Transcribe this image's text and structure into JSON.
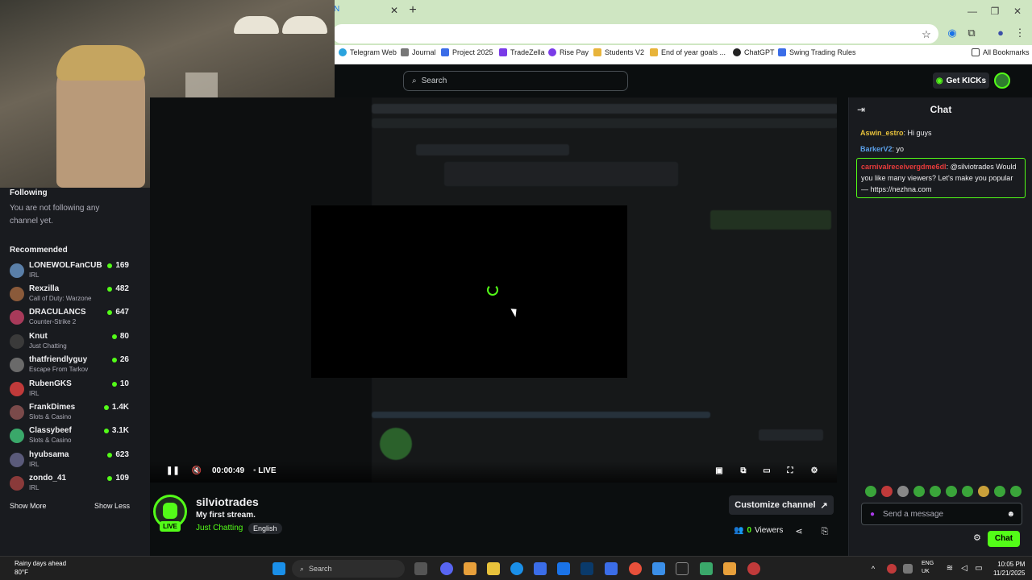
{
  "browser": {
    "close_glyph": "✕",
    "new_tab_glyph": "+",
    "bookmarks": [
      {
        "label": "Telegram Web",
        "color": "#2aa3de"
      },
      {
        "label": "Journal",
        "color": "#777777"
      },
      {
        "label": "Project 2025",
        "color": "#3b6de8"
      },
      {
        "label": "TradeZella",
        "color": "#7a3be8"
      },
      {
        "label": "Rise Pay",
        "color": "#7a3be8"
      },
      {
        "label": "Students V2",
        "color": "#e8b43b"
      },
      {
        "label": "End of year goals ...",
        "color": "#e8b43b"
      },
      {
        "label": "ChatGPT",
        "color": "#222222"
      },
      {
        "label": "Swing Trading Rules",
        "color": "#3b6de8"
      }
    ],
    "all_bookmarks": "All Bookmarks"
  },
  "header": {
    "search_placeholder": "Search",
    "get_kicks": "Get KICKs"
  },
  "sidebar": {
    "following_heading": "Following",
    "not_following_text": "You are not following any channel yet.",
    "recommended_heading": "Recommended",
    "channels": [
      {
        "name": "LONEWOLFanCUB",
        "category": "IRL",
        "viewers": "169",
        "color": "#5a7fa8"
      },
      {
        "name": "Rexzilla",
        "category": "Call of Duty: Warzone",
        "viewers": "482",
        "color": "#8a5a3a"
      },
      {
        "name": "DRACULANCS",
        "category": "Counter-Strike 2",
        "viewers": "647",
        "color": "#a83a5a"
      },
      {
        "name": "Knut",
        "category": "Just Chatting",
        "viewers": "80",
        "color": "#3a3a3a"
      },
      {
        "name": "thatfriendlyguy",
        "category": "Escape From Tarkov",
        "viewers": "26",
        "color": "#6a6a6a"
      },
      {
        "name": "RubenGKS",
        "category": "IRL",
        "viewers": "10",
        "color": "#c03a3a"
      },
      {
        "name": "FrankDimes",
        "category": "Slots & Casino",
        "viewers": "1.4K",
        "color": "#7a4a4a"
      },
      {
        "name": "Classybeef",
        "category": "Slots & Casino",
        "viewers": "3.1K",
        "color": "#3aa86a"
      },
      {
        "name": "hyubsama",
        "category": "IRL",
        "viewers": "623",
        "color": "#5a5a7a"
      },
      {
        "name": "zondo_41",
        "category": "IRL",
        "viewers": "109",
        "color": "#8a3a3a"
      }
    ],
    "show_more": "Show More",
    "show_less": "Show Less"
  },
  "player": {
    "elapsed": "00:00:49",
    "live_label": "LIVE"
  },
  "stream": {
    "streamer": "silviotrades",
    "title": "My first stream.",
    "category": "Just Chatting",
    "language": "English",
    "live_badge": "LIVE",
    "customize_label": "Customize channel",
    "viewer_count": "0",
    "viewers_label": "Viewers"
  },
  "chat": {
    "title": "Chat",
    "messages": [
      {
        "user": "Aswin_estro",
        "user_color": "#e8c23b",
        "text": ": Hi guys"
      },
      {
        "user": "BarkerV2",
        "user_color": "#5a9fe8",
        "text": ": yo"
      },
      {
        "user": "carnivalreceivergdme6dl",
        "user_color": "#e83b3b",
        "text": ": @silviotrades Would you like many viewers? Let's make you popular — https://nezhna.com"
      }
    ],
    "input_placeholder": "Send a message",
    "send_label": "Chat"
  },
  "taskbar": {
    "weather_line1": "Rainy days ahead",
    "weather_line2": "80°F",
    "search_label": "Search",
    "lang_line1": "ENG",
    "lang_line2": "UK",
    "time": "10:05 PM",
    "date": "11/21/2025"
  }
}
